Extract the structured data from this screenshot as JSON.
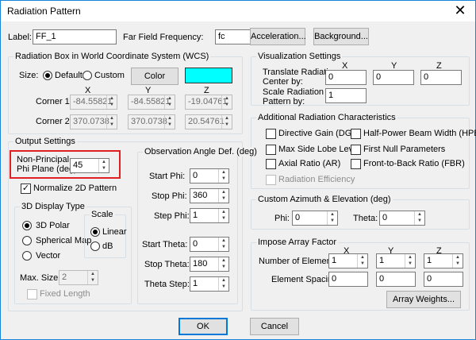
{
  "window": {
    "title": "Radiation Pattern",
    "close_glyph": "✕"
  },
  "top": {
    "label_label": "Label:",
    "label_value": "FF_1",
    "freq_label": "Far Field Frequency:",
    "freq_value": "fc",
    "acceleration_btn": "Acceleration...",
    "background_btn": "Background..."
  },
  "radbox": {
    "title": "Radiation Box in World Coordinate System (WCS)",
    "size_label": "Size:",
    "default_label": "Default",
    "custom_label": "Custom",
    "size_selected": "Default",
    "color_btn": "Color",
    "color_swatch": "#00ffff",
    "x": "X",
    "y": "Y",
    "z": "Z",
    "corner1_label": "Corner 1:",
    "corner2_label": "Corner 2:",
    "corner1": [
      "-84.55821",
      "-84.55821",
      "-19.04761"
    ],
    "corner2": [
      "370.0738",
      "370.0738",
      "20.54761"
    ]
  },
  "vis": {
    "title": "Visualization Settings",
    "x": "X",
    "y": "Y",
    "z": "Z",
    "translate_label1": "Translate Radiation",
    "translate_label2": "Center by:",
    "translate": [
      "0",
      "0",
      "0"
    ],
    "scale_label1": "Scale Radiation",
    "scale_label2": "Pattern by:",
    "scale": "1"
  },
  "addl": {
    "title": "Additional Radiation Characteristics",
    "items": [
      "Directive Gain (DG)",
      "Half-Power Beam Width (HPBW)",
      "Max Side Lobe Level",
      "First Null Parameters",
      "Axial Ratio (AR)",
      "Front-to-Back Ratio (FBR)",
      "Radiation Efficiency"
    ]
  },
  "output": {
    "title": "Output Settings",
    "npp_label1": "Non-Principal",
    "npp_label2": "Phi Plane (deg):",
    "npp_value": "45",
    "normalize_label": "Normalize 2D Pattern",
    "normalize_checked": true
  },
  "display3d": {
    "title": "3D Display Type",
    "options": [
      "3D Polar",
      "Spherical Map",
      "Vector"
    ],
    "selected": "3D Polar",
    "scale_title": "Scale",
    "scale_options": [
      "Linear",
      "dB"
    ],
    "scale_selected": "Linear",
    "maxsize_label": "Max. Size:",
    "maxsize_value": "2",
    "fixed_label": "Fixed Length"
  },
  "obs": {
    "title": "Observation Angle Def. (deg)",
    "start_phi_label": "Start Phi:",
    "start_phi": "0",
    "stop_phi_label": "Stop Phi:",
    "stop_phi": "360",
    "step_phi_label": "Step Phi:",
    "step_phi": "1",
    "start_theta_label": "Start Theta:",
    "start_theta": "0",
    "stop_theta_label": "Stop Theta:",
    "stop_theta": "180",
    "theta_step_label": "Theta Step:",
    "theta_step": "1"
  },
  "custom": {
    "title": "Custom Azimuth & Elevation (deg)",
    "phi_label": "Phi:",
    "phi": "0",
    "theta_label": "Theta:",
    "theta": "0"
  },
  "array": {
    "title": "Impose Array Factor",
    "x": "X",
    "y": "Y",
    "z": "Z",
    "num_label": "Number of Elements:",
    "num": [
      "1",
      "1",
      "1"
    ],
    "spacing_label": "Element Spacing:",
    "spacing": [
      "0",
      "0",
      "0"
    ],
    "weights_btn": "Array Weights..."
  },
  "footer": {
    "ok": "OK",
    "cancel": "Cancel"
  }
}
